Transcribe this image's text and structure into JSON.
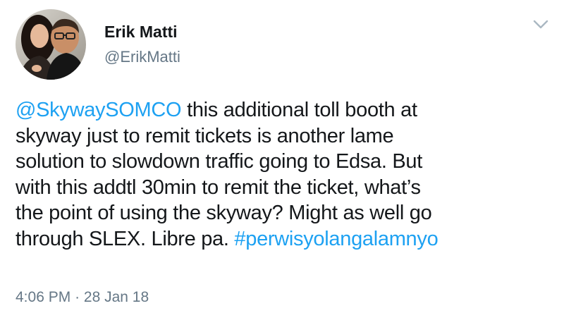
{
  "author": {
    "display_name": "Erik Matti",
    "handle": "@ErikMatti",
    "avatar_icon": "profile-photo-avatar"
  },
  "tweet": {
    "lines": [
      {
        "mention": "@SkywaySOMCO",
        "text": " this additional toll booth at"
      },
      {
        "text": "skyway just to remit tickets is another lame"
      },
      {
        "text": "solution to slowdown traffic going to Edsa. But"
      },
      {
        "text": "with this addtl 30min to remit the ticket, what’s"
      },
      {
        "text": "the point of using the skyway? Might as well go"
      },
      {
        "text": "through SLEX. Libre pa. ",
        "hashtag": "#perwisyolangalamnyo"
      }
    ]
  },
  "meta": {
    "time": "4:06 PM",
    "separator": "·",
    "date": "28 Jan 18"
  },
  "colors": {
    "link": "#1da1f2",
    "secondary_text": "#657786",
    "primary_text": "#14171a"
  },
  "icons": {
    "menu": "chevron-down-icon"
  }
}
